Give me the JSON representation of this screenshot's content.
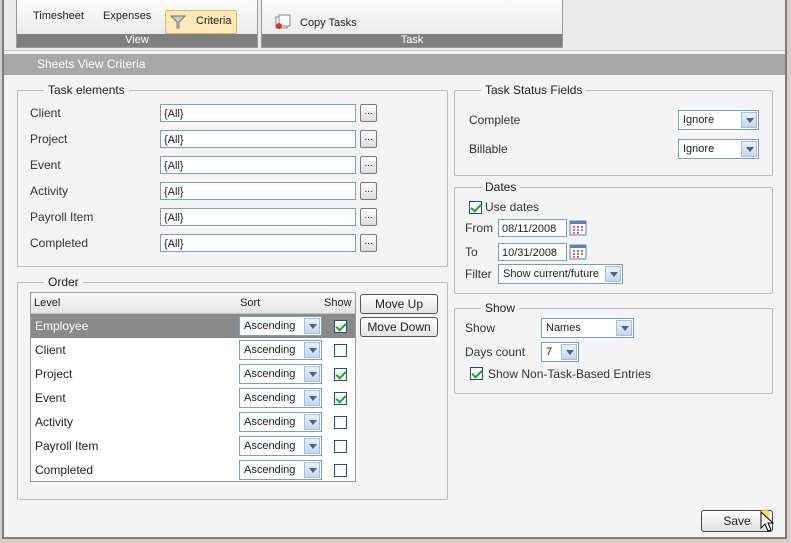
{
  "ribbon": {
    "view_group": {
      "title": "View",
      "timesheet": "Timesheet",
      "expenses": "Expenses",
      "criteria": "Criteria"
    },
    "task_group": {
      "title": "Task",
      "copy_tasks": "Copy Tasks"
    }
  },
  "header": {
    "title": "Sheets View Criteria"
  },
  "task_elements": {
    "legend": "Task elements",
    "rows": [
      {
        "label": "Client",
        "value": "{All}"
      },
      {
        "label": "Project",
        "value": "{All}"
      },
      {
        "label": "Event",
        "value": "{All}"
      },
      {
        "label": "Activity",
        "value": "{All}"
      },
      {
        "label": "Payroll Item",
        "value": "{All}"
      },
      {
        "label": "Completed",
        "value": "{All}"
      }
    ],
    "browse_label": "..."
  },
  "order": {
    "legend": "Order",
    "headers": {
      "level": "Level",
      "sort": "Sort",
      "show": "Show"
    },
    "rows": [
      {
        "level": "Employee",
        "sort": "Ascending",
        "show": true
      },
      {
        "level": "Client",
        "sort": "Ascending",
        "show": false
      },
      {
        "level": "Project",
        "sort": "Ascending",
        "show": true
      },
      {
        "level": "Event",
        "sort": "Ascending",
        "show": true
      },
      {
        "level": "Activity",
        "sort": "Ascending",
        "show": false
      },
      {
        "level": "Payroll Item",
        "sort": "Ascending",
        "show": false
      },
      {
        "level": "Completed",
        "sort": "Ascending",
        "show": false
      }
    ],
    "move_up": "Move Up",
    "move_down": "Move Down"
  },
  "task_status": {
    "legend": "Task Status Fields",
    "complete_label": "Complete",
    "complete_value": "Ignore",
    "billable_label": "Billable",
    "billable_value": "Ignore"
  },
  "dates": {
    "legend": "Dates",
    "use_dates_label": "Use dates",
    "use_dates": true,
    "from_label": "From",
    "from_value": "08/11/2008",
    "to_label": "To",
    "to_value": "10/31/2008",
    "filter_label": "Filter",
    "filter_value": "Show current/future"
  },
  "show": {
    "legend": "Show",
    "show_label": "Show",
    "show_value": "Names",
    "days_label": "Days count",
    "days_value": "7",
    "non_task_label": "Show Non-Task-Based Entries",
    "non_task": true
  },
  "save_label": "Save",
  "colors": {
    "header_bar": "#a8a8a8",
    "selected_row": "#8a8a8a",
    "check": "#21a121",
    "active_button": "#fde9b8"
  }
}
